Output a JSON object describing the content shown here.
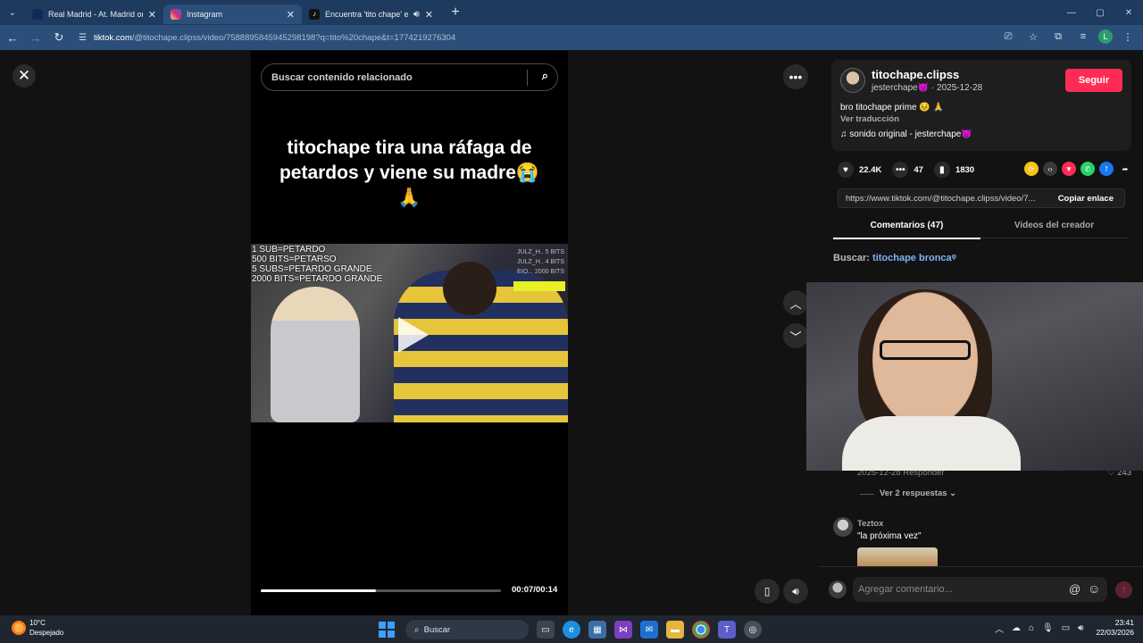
{
  "browser": {
    "tabs": [
      {
        "title": "Real Madrid - At. Madrid online",
        "favicon_color": "#0f2a57",
        "active": false
      },
      {
        "title": "Instagram",
        "favicon_color": "#d6249f",
        "active": true
      },
      {
        "title": "Encuentra 'tito chape' en TikTok",
        "favicon_color": "#111111",
        "active": false
      }
    ],
    "url_host": "tiktok.com",
    "url_path": "/@titochape.clipss/video/7588895845945298198?q=tito%20chape&t=1774219276304",
    "profile_initial": "L"
  },
  "video": {
    "search_placeholder": "Buscar contenido relacionado",
    "caption": "titochape tira una ráfaga de petardos y viene su madre😭🙏",
    "overlay_lines": [
      "1 SUB=PETARDO",
      "500 BITS=PETARSO",
      "5 SUBS=PETARDO GRANDE",
      "2000 BITS=PETARDO GRANDE"
    ],
    "overlay_right": [
      "JULZ_H.. 5 BITS",
      "JULZ_H.. 4 BITS",
      "EIO... 2000 BITS"
    ],
    "progress_fraction": 0.48,
    "time": "00:07/00:14"
  },
  "author": {
    "username": "titochape.clipss",
    "subline": "jesterchape😈 · 2025-12-28",
    "follow_label": "Seguir",
    "description": "bro titochape prime 😣 🙏",
    "translate_label": "Ver traducción",
    "sound": "sonido original - jesterchape😈"
  },
  "stats": {
    "likes": "22.4K",
    "comments": "47",
    "saves": "1830"
  },
  "share": {
    "link": "https://www.tiktok.com/@titochape.clipss/video/7...",
    "copy_label": "Copiar enlace",
    "icon_colors": [
      "#f5c518",
      "#3a3a3a",
      "#fe2c55",
      "#25d366",
      "#1877f2",
      "#2a2a2a"
    ]
  },
  "comments_panel": {
    "tab_comments": "Comentarios (47)",
    "tab_creator": "Videos del creador",
    "search_prefix": "Buscar:",
    "search_query": "titochape broncaᵠ",
    "c1_date": "2025-12-28   Responder",
    "c1_likes": "♡ 243",
    "c1_replies": "Ver 2 respuestas ⌄",
    "c2_user": "Teztox",
    "c2_text": "\"la próxima vez\"",
    "input_placeholder": "Agregar comentario..."
  },
  "taskbar": {
    "temp": "10°C",
    "weather": "Despejado",
    "search_label": "Buscar",
    "time": "23:41",
    "date": "22/03/2026"
  }
}
